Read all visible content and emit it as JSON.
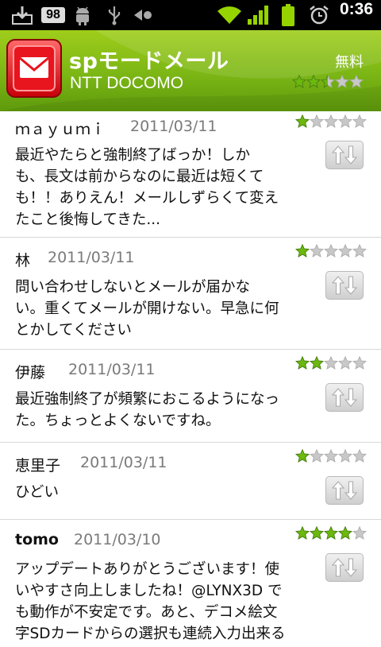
{
  "status_bar": {
    "badge_count": "98",
    "time": "0:36",
    "icons": [
      "download-icon",
      "notification-count-badge",
      "android-debug-icon",
      "usb-icon",
      "back-arrow-icon",
      "wifi-icon",
      "signal-icon",
      "battery-icon",
      "alarm-icon"
    ]
  },
  "app": {
    "title": "spモードメール",
    "developer": "NTT DOCOMO",
    "price": "無料",
    "rating": 2.5,
    "rating_max": 5,
    "icon": "mail-envelope-icon"
  },
  "colors": {
    "header_green": "#7bb615",
    "star_green": "#6cb80e",
    "star_empty": "#c8c8c8"
  },
  "reviews": [
    {
      "author": "ｍａｙｕｍｉ",
      "date": "2011/03/11",
      "rating": 1,
      "lines": [
        "最近やたらと強制終了ばっか！しか",
        "も、長文は前からなのに最近は短くて",
        "も！！ありえん！メールしずらくて変え",
        "たこと後悔してきた..."
      ]
    },
    {
      "author": "林",
      "date": "2011/03/11",
      "rating": 1,
      "lines": [
        "問い合わせしないとメールが届かな",
        "い。重くてメールが開けない。早急に何",
        "とかしてください"
      ]
    },
    {
      "author": "伊藤",
      "date": "2011/03/11",
      "rating": 2,
      "lines": [
        "最近強制終了が頻繁におこるようになっ",
        "た。ちょっとよくないですね。"
      ]
    },
    {
      "author": "恵里子",
      "date": "2011/03/11",
      "rating": 1,
      "lines": [
        "ひどい"
      ]
    },
    {
      "author": "tomo",
      "date": "2011/03/10",
      "rating": 4,
      "lines": [
        "アップデートありがとうございます！使",
        "いやすさ向上しましたね！@LYNX3D で",
        "も動作が不安定です。あと、デコメ絵文",
        "字SDカードからの選択も連続入力出来る"
      ]
    }
  ]
}
